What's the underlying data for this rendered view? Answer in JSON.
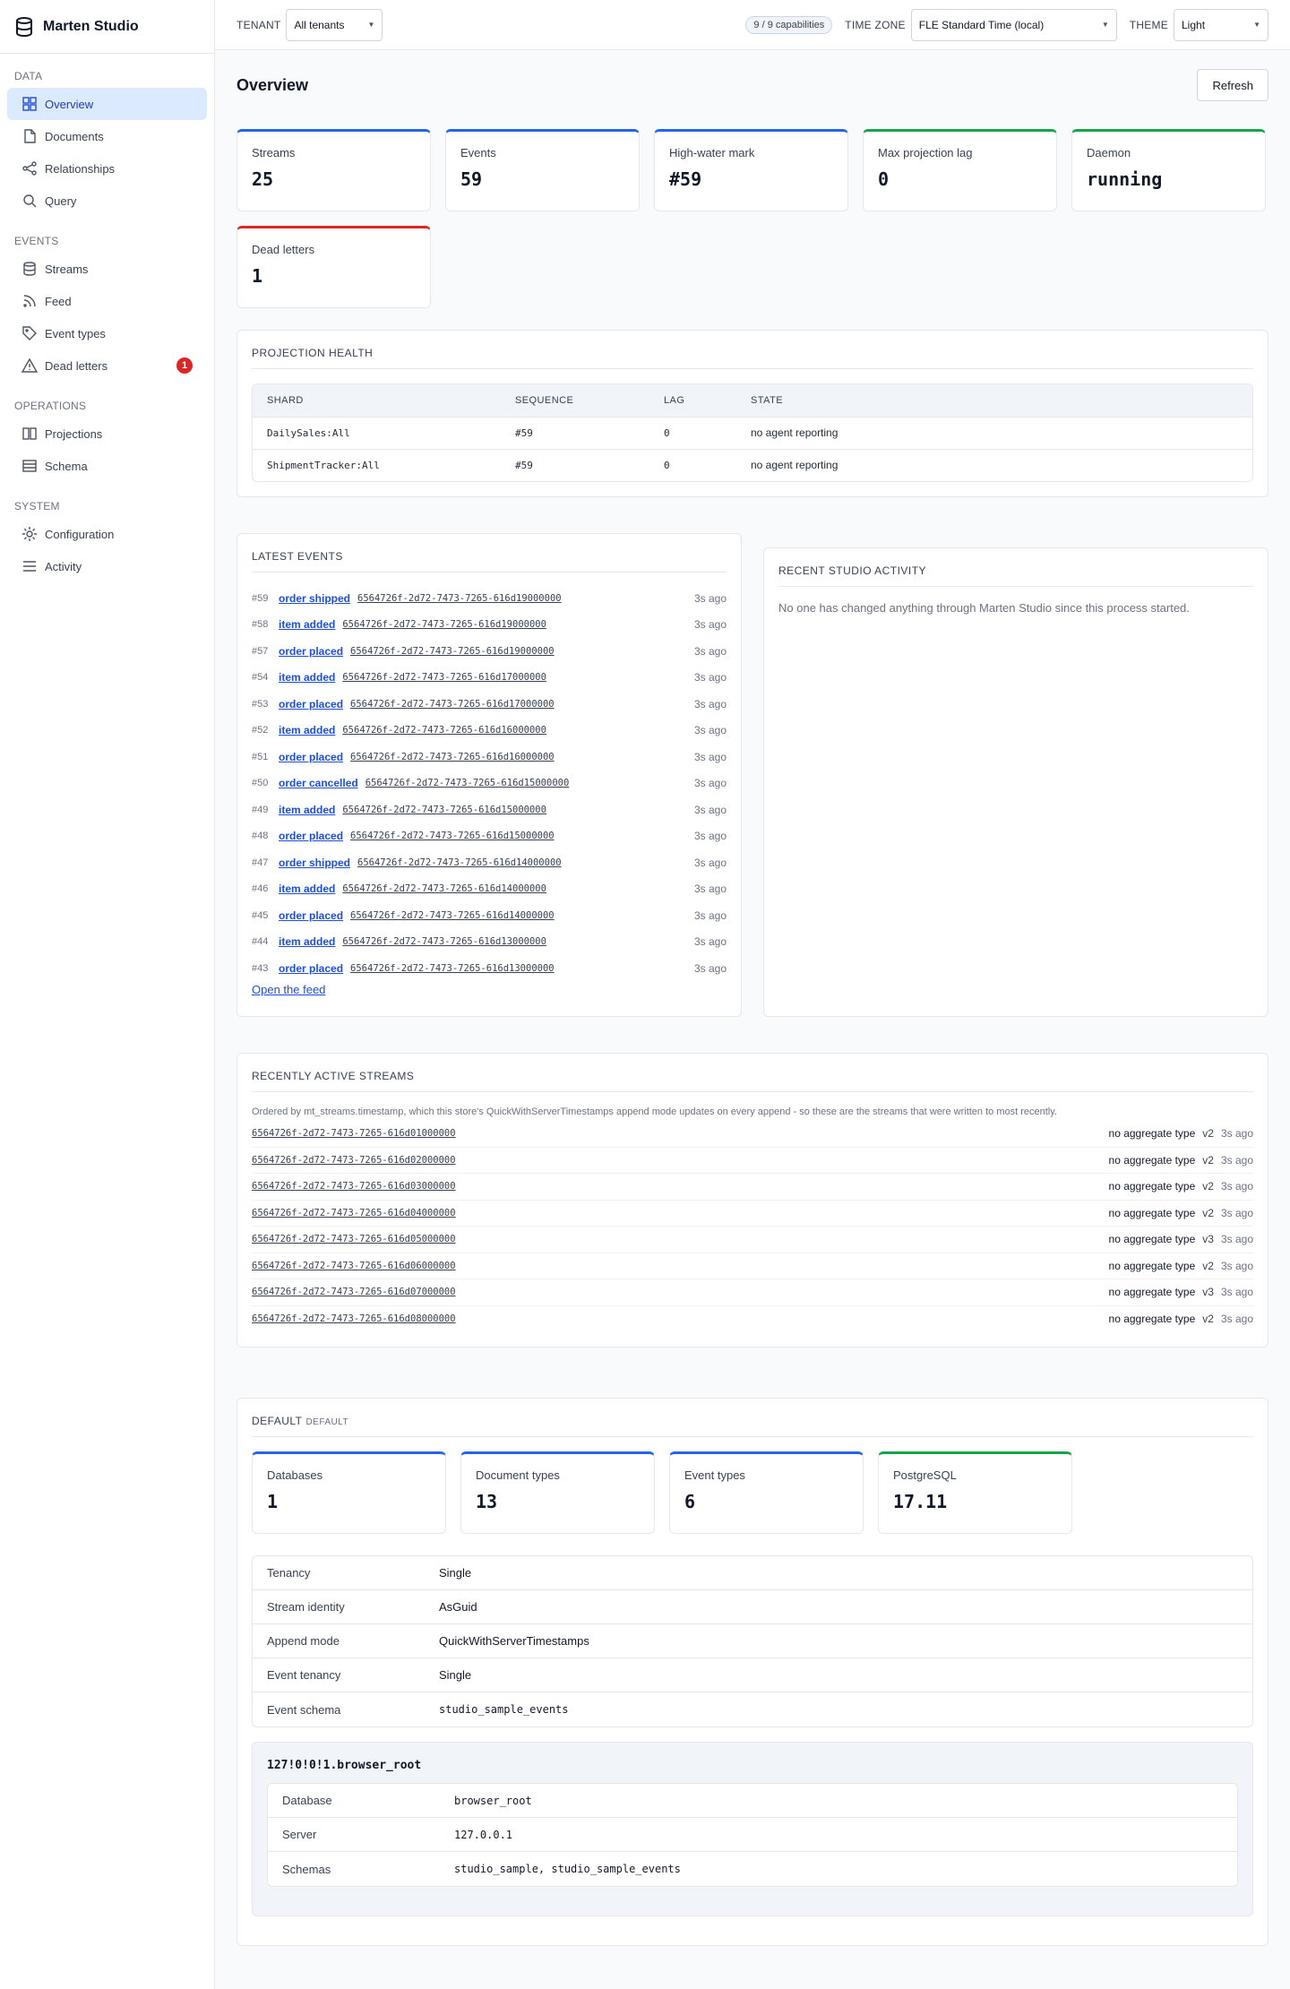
{
  "app": {
    "title": "Marten Studio"
  },
  "sidebar": {
    "sections": [
      {
        "title": "DATA",
        "items": [
          {
            "label": "Overview",
            "icon": "grid-icon",
            "active": true
          },
          {
            "label": "Documents",
            "icon": "document-icon"
          },
          {
            "label": "Relationships",
            "icon": "share-icon"
          },
          {
            "label": "Query",
            "icon": "search-icon"
          }
        ]
      },
      {
        "title": "EVENTS",
        "items": [
          {
            "label": "Streams",
            "icon": "database-icon"
          },
          {
            "label": "Feed",
            "icon": "rss-icon"
          },
          {
            "label": "Event types",
            "icon": "tag-icon"
          },
          {
            "label": "Dead letters",
            "icon": "warning-icon",
            "badge": "1"
          }
        ]
      },
      {
        "title": "OPERATIONS",
        "items": [
          {
            "label": "Projections",
            "icon": "columns-icon"
          },
          {
            "label": "Schema",
            "icon": "table-icon"
          }
        ]
      },
      {
        "title": "SYSTEM",
        "items": [
          {
            "label": "Configuration",
            "icon": "gear-icon"
          },
          {
            "label": "Activity",
            "icon": "list-icon"
          }
        ]
      }
    ]
  },
  "topbar": {
    "tenant_label": "TENANT",
    "tenant_value": "All tenants",
    "capabilities": "9 / 9 capabilities",
    "timezone_label": "TIME ZONE",
    "timezone_value": "FLE Standard Time (local)",
    "theme_label": "THEME",
    "theme_value": "Light"
  },
  "page": {
    "title": "Overview",
    "refresh_label": "Refresh"
  },
  "stats": [
    {
      "label": "Streams",
      "value": "25",
      "accent": "#2563eb"
    },
    {
      "label": "Events",
      "value": "59",
      "accent": "#2563eb"
    },
    {
      "label": "High-water mark",
      "value": "#59",
      "accent": "#2563eb"
    },
    {
      "label": "Max projection lag",
      "value": "0",
      "accent": "#16a34a"
    },
    {
      "label": "Daemon",
      "value": "running",
      "accent": "#16a34a"
    },
    {
      "label": "Dead letters",
      "value": "1",
      "accent": "#dc2626"
    }
  ],
  "projection_health": {
    "title": "PROJECTION HEALTH",
    "columns": [
      "SHARD",
      "SEQUENCE",
      "LAG",
      "STATE"
    ],
    "rows": [
      [
        "DailySales:All",
        "#59",
        "0",
        "no agent reporting"
      ],
      [
        "ShipmentTracker:All",
        "#59",
        "0",
        "no agent reporting"
      ]
    ]
  },
  "latest_events": {
    "title": "LATEST EVENTS",
    "items": [
      {
        "seq": "#59",
        "type": "order shipped",
        "stream": "6564726f-2d72-7473-7265-616d19000000",
        "age": "3s ago"
      },
      {
        "seq": "#58",
        "type": "item added",
        "stream": "6564726f-2d72-7473-7265-616d19000000",
        "age": "3s ago"
      },
      {
        "seq": "#57",
        "type": "order placed",
        "stream": "6564726f-2d72-7473-7265-616d19000000",
        "age": "3s ago"
      },
      {
        "seq": "#54",
        "type": "item added",
        "stream": "6564726f-2d72-7473-7265-616d17000000",
        "age": "3s ago"
      },
      {
        "seq": "#53",
        "type": "order placed",
        "stream": "6564726f-2d72-7473-7265-616d17000000",
        "age": "3s ago"
      },
      {
        "seq": "#52",
        "type": "item added",
        "stream": "6564726f-2d72-7473-7265-616d16000000",
        "age": "3s ago"
      },
      {
        "seq": "#51",
        "type": "order placed",
        "stream": "6564726f-2d72-7473-7265-616d16000000",
        "age": "3s ago"
      },
      {
        "seq": "#50",
        "type": "order cancelled",
        "stream": "6564726f-2d72-7473-7265-616d15000000",
        "age": "3s ago"
      },
      {
        "seq": "#49",
        "type": "item added",
        "stream": "6564726f-2d72-7473-7265-616d15000000",
        "age": "3s ago"
      },
      {
        "seq": "#48",
        "type": "order placed",
        "stream": "6564726f-2d72-7473-7265-616d15000000",
        "age": "3s ago"
      },
      {
        "seq": "#47",
        "type": "order shipped",
        "stream": "6564726f-2d72-7473-7265-616d14000000",
        "age": "3s ago"
      },
      {
        "seq": "#46",
        "type": "item added",
        "stream": "6564726f-2d72-7473-7265-616d14000000",
        "age": "3s ago"
      },
      {
        "seq": "#45",
        "type": "order placed",
        "stream": "6564726f-2d72-7473-7265-616d14000000",
        "age": "3s ago"
      },
      {
        "seq": "#44",
        "type": "item added",
        "stream": "6564726f-2d72-7473-7265-616d13000000",
        "age": "3s ago"
      },
      {
        "seq": "#43",
        "type": "order placed",
        "stream": "6564726f-2d72-7473-7265-616d13000000",
        "age": "3s ago"
      }
    ],
    "open_feed_label": "Open the feed"
  },
  "recent_activity": {
    "title": "RECENT STUDIO ACTIVITY",
    "empty_text": "No one has changed anything through Marten Studio since this process started."
  },
  "recent_streams": {
    "title": "RECENTLY ACTIVE STREAMS",
    "note": "Ordered by mt_streams.timestamp, which this store's QuickWithServerTimestamps append mode updates on every append - so these are the streams that were written to most recently.",
    "items": [
      {
        "id": "6564726f-2d72-7473-7265-616d01000000",
        "aggregate": "no aggregate type",
        "version": "v2",
        "age": "3s ago"
      },
      {
        "id": "6564726f-2d72-7473-7265-616d02000000",
        "aggregate": "no aggregate type",
        "version": "v2",
        "age": "3s ago"
      },
      {
        "id": "6564726f-2d72-7473-7265-616d03000000",
        "aggregate": "no aggregate type",
        "version": "v2",
        "age": "3s ago"
      },
      {
        "id": "6564726f-2d72-7473-7265-616d04000000",
        "aggregate": "no aggregate type",
        "version": "v2",
        "age": "3s ago"
      },
      {
        "id": "6564726f-2d72-7473-7265-616d05000000",
        "aggregate": "no aggregate type",
        "version": "v3",
        "age": "3s ago"
      },
      {
        "id": "6564726f-2d72-7473-7265-616d06000000",
        "aggregate": "no aggregate type",
        "version": "v2",
        "age": "3s ago"
      },
      {
        "id": "6564726f-2d72-7473-7265-616d07000000",
        "aggregate": "no aggregate type",
        "version": "v3",
        "age": "3s ago"
      },
      {
        "id": "6564726f-2d72-7473-7265-616d08000000",
        "aggregate": "no aggregate type",
        "version": "v2",
        "age": "3s ago"
      }
    ]
  },
  "default_store": {
    "title": "DEFAULT",
    "subtitle": "DEFAULT",
    "stats": [
      {
        "label": "Databases",
        "value": "1",
        "accent": "#2563eb"
      },
      {
        "label": "Document types",
        "value": "13",
        "accent": "#2563eb"
      },
      {
        "label": "Event types",
        "value": "6",
        "accent": "#2563eb"
      },
      {
        "label": "PostgreSQL",
        "value": "17.11",
        "accent": "#16a34a"
      }
    ],
    "settings": [
      {
        "key": "Tenancy",
        "value": "Single",
        "mono": false
      },
      {
        "key": "Stream identity",
        "value": "AsGuid",
        "mono": false
      },
      {
        "key": "Append mode",
        "value": "QuickWithServerTimestamps",
        "mono": false
      },
      {
        "key": "Event tenancy",
        "value": "Single",
        "mono": false
      },
      {
        "key": "Event schema",
        "value": "studio_sample_events",
        "mono": true
      }
    ],
    "database": {
      "title": "127!0!0!1.browser_root",
      "rows": [
        {
          "key": "Database",
          "value": "browser_root"
        },
        {
          "key": "Server",
          "value": "127.0.0.1"
        },
        {
          "key": "Schemas",
          "value": "studio_sample, studio_sample_events"
        }
      ]
    }
  }
}
